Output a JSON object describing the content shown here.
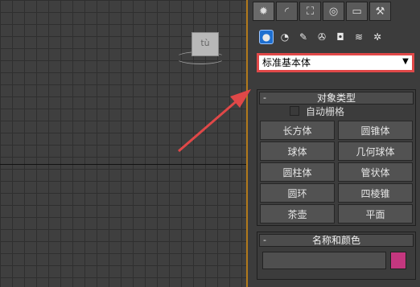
{
  "viewport": {
    "object_label": "tù"
  },
  "panel": {
    "top_tabs": [
      {
        "icon": "create-icon",
        "glyph": "✹",
        "active": true
      },
      {
        "icon": "modify-icon",
        "glyph": "◜"
      },
      {
        "icon": "hierarchy-icon",
        "glyph": "⛶"
      },
      {
        "icon": "motion-icon",
        "glyph": "◎"
      },
      {
        "icon": "display-icon",
        "glyph": "▭"
      },
      {
        "icon": "utilities-icon",
        "glyph": "⚒"
      }
    ],
    "sub_icons": [
      {
        "icon": "geometry-icon",
        "glyph": "●",
        "active": true
      },
      {
        "icon": "shapes-icon",
        "glyph": "◔"
      },
      {
        "icon": "lights-icon",
        "glyph": "✎"
      },
      {
        "icon": "cameras-icon",
        "glyph": "✇"
      },
      {
        "icon": "helpers-icon",
        "glyph": "◘"
      },
      {
        "icon": "spacewarps-icon",
        "glyph": "≋"
      },
      {
        "icon": "systems-icon",
        "glyph": "✲"
      }
    ],
    "dropdown": {
      "selected": "标准基本体",
      "arrow": "▼"
    },
    "object_type": {
      "title": "对象类型",
      "collapse": "-",
      "autogrid_label": "自动栅格",
      "buttons": [
        "长方体",
        "圆锥体",
        "球体",
        "几何球体",
        "圆柱体",
        "管状体",
        "圆环",
        "四棱锥",
        "茶壶",
        "平面"
      ]
    },
    "name_color": {
      "title": "名称和颜色",
      "collapse": "-",
      "name_value": "",
      "swatch_color": "#c4377f"
    }
  },
  "colors": {
    "accent_highlight": "#e04848",
    "axis": "#b27a1c"
  }
}
